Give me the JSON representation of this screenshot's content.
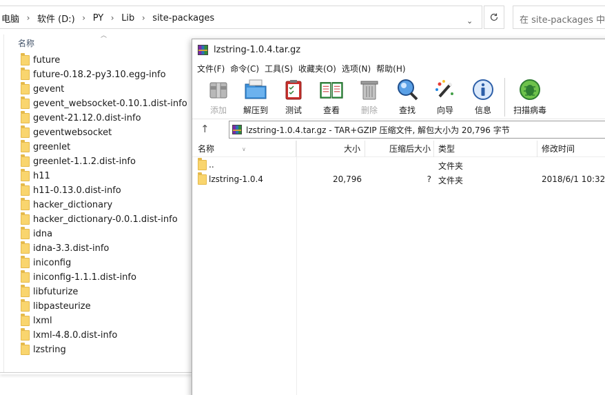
{
  "explorer": {
    "breadcrumbs": [
      "电脑",
      "软件 (D:)",
      "PY",
      "Lib",
      "site-packages"
    ],
    "search_placeholder": "在 site-packages 中搜索",
    "column_name": "名称",
    "items": [
      "future",
      "future-0.18.2-py3.10.egg-info",
      "gevent",
      "gevent_websocket-0.10.1.dist-info",
      "gevent-21.12.0.dist-info",
      "geventwebsocket",
      "greenlet",
      "greenlet-1.1.2.dist-info",
      "h11",
      "h11-0.13.0.dist-info",
      "hacker_dictionary",
      "hacker_dictionary-0.0.1.dist-info",
      "idna",
      "idna-3.3.dist-info",
      "iniconfig",
      "iniconfig-1.1.1.dist-info",
      "libfuturize",
      "libpasteurize",
      "lxml",
      "lxml-4.8.0.dist-info",
      "lzstring"
    ]
  },
  "archive": {
    "title": "lzstring-1.0.4.tar.gz",
    "menu": [
      "文件(F)",
      "命令(C)",
      "工具(S)",
      "收藏夹(O)",
      "选项(N)",
      "帮助(H)"
    ],
    "toolbar": {
      "add": "添加",
      "extract": "解压到",
      "test": "测试",
      "view": "查看",
      "delete": "删除",
      "find": "查找",
      "wizard": "向导",
      "info": "信息",
      "scan": "扫描病毒"
    },
    "path_text": "lzstring-1.0.4.tar.gz - TAR+GZIP 压缩文件, 解包大小为 20,796 字节",
    "columns": {
      "name": "名称",
      "size": "大小",
      "packed": "压缩后大小",
      "type": "类型",
      "modified": "修改时间"
    },
    "rows": [
      {
        "name": "..",
        "size": "",
        "packed": "",
        "type": "文件夹",
        "modified": ""
      },
      {
        "name": "lzstring-1.0.4",
        "size": "20,796",
        "packed": "?",
        "type": "文件夹",
        "modified": "2018/6/1 10:32"
      }
    ]
  },
  "colors": {
    "folder": "#f9d56e",
    "accent_blue": "#2d6fb3"
  }
}
